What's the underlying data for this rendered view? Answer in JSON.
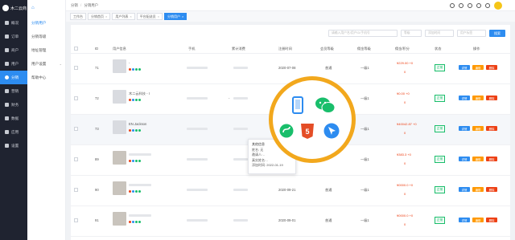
{
  "brand": {
    "name": "木二云商"
  },
  "sidebar": {
    "items": [
      {
        "label": "概况",
        "icon": "overview-icon"
      },
      {
        "label": "订单",
        "icon": "order-icon"
      },
      {
        "label": "商户",
        "icon": "store-icon"
      },
      {
        "label": "用户",
        "icon": "user-icon"
      },
      {
        "label": "分销",
        "icon": "distribution-icon"
      },
      {
        "label": "营销",
        "icon": "marketing-icon"
      },
      {
        "label": "财务",
        "icon": "finance-icon"
      },
      {
        "label": "数据",
        "icon": "data-icon"
      },
      {
        "label": "应用",
        "icon": "apps-icon"
      },
      {
        "label": "设置",
        "icon": "settings-icon"
      }
    ],
    "active_index": 4
  },
  "submenu": {
    "items": [
      {
        "label": "分销用户"
      },
      {
        "label": "分销等级"
      },
      {
        "label": "地址管理"
      },
      {
        "label": "用户设置"
      },
      {
        "label": "帮助中心"
      }
    ]
  },
  "header": {
    "breadcrumb": [
      "分销",
      "分销用户"
    ]
  },
  "tabs": [
    {
      "label": "工作台"
    },
    {
      "label": "分销首页"
    },
    {
      "label": "用户列表"
    },
    {
      "label": "平台配送员"
    },
    {
      "label": "分销用户"
    }
  ],
  "filters": {
    "search_placeholder": "请输入用户名/用户ID/手机号",
    "select1": "等级",
    "select2": "添加时间",
    "select3": "用户标签",
    "search_button": "搜索"
  },
  "table": {
    "headers": [
      "ID",
      "用户信息",
      "手机",
      "累计消费",
      "注册时间",
      "会员等级",
      "佣金等级",
      "佣金/积分",
      "状态",
      "操作"
    ],
    "rows": [
      {
        "id": "71",
        "name": "-",
        "phone": "",
        "spent": "",
        "reg": "2020-07-08",
        "level": "普通",
        "comm_level": "一级1",
        "amount": "¥229.00 +0",
        "sub": "0",
        "status": "正常"
      },
      {
        "id": "72",
        "name": "木二云科技 - I",
        "phone": "-",
        "spent": "",
        "reg": "2020-07-08",
        "level": "",
        "comm_level": "一级1",
        "amount": "¥0.00 +0",
        "sub": "0",
        "status": "正常"
      },
      {
        "id": "73",
        "name": "EN.Jackson",
        "phone": "",
        "spent": "",
        "reg": "",
        "level": "",
        "comm_level": "一级1",
        "amount": "¥40042.87 +0",
        "sub": "0",
        "status": "正常"
      },
      {
        "id": "89",
        "name": "",
        "phone": "",
        "spent": "",
        "reg": "2020-08-0",
        "level": "",
        "comm_level": "一级1",
        "amount": "¥383.3 +0",
        "sub": "0",
        "status": "正常"
      },
      {
        "id": "90",
        "name": "",
        "phone": "",
        "spent": "",
        "reg": "2020-09-21",
        "level": "普通",
        "comm_level": "一级1",
        "amount": "¥0000.0 +0",
        "sub": "0",
        "status": "正常"
      },
      {
        "id": "91",
        "name": "",
        "phone": "",
        "spent": "",
        "reg": "2020-09-01",
        "level": "普通",
        "comm_level": "一级1",
        "amount": "¥0000.0 +0",
        "sub": "0",
        "status": "正常"
      }
    ],
    "ops": [
      "详情",
      "编辑",
      "删除"
    ]
  },
  "tooltip": {
    "title": "其他信息",
    "lines": [
      "姓名: 无",
      "邀请人: -",
      "真实姓名: -",
      "添加时间: 2022-01-19"
    ]
  }
}
